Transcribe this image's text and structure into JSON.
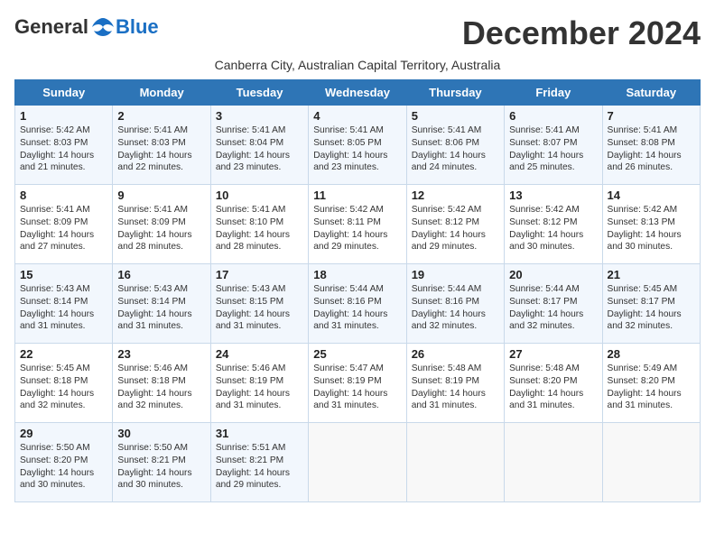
{
  "header": {
    "logo_general": "General",
    "logo_blue": "Blue",
    "month_title": "December 2024",
    "subtitle": "Canberra City, Australian Capital Territory, Australia"
  },
  "days_of_week": [
    "Sunday",
    "Monday",
    "Tuesday",
    "Wednesday",
    "Thursday",
    "Friday",
    "Saturday"
  ],
  "weeks": [
    [
      {
        "day": "1",
        "lines": [
          "Sunrise: 5:42 AM",
          "Sunset: 8:03 PM",
          "Daylight: 14 hours",
          "and 21 minutes."
        ]
      },
      {
        "day": "2",
        "lines": [
          "Sunrise: 5:41 AM",
          "Sunset: 8:03 PM",
          "Daylight: 14 hours",
          "and 22 minutes."
        ]
      },
      {
        "day": "3",
        "lines": [
          "Sunrise: 5:41 AM",
          "Sunset: 8:04 PM",
          "Daylight: 14 hours",
          "and 23 minutes."
        ]
      },
      {
        "day": "4",
        "lines": [
          "Sunrise: 5:41 AM",
          "Sunset: 8:05 PM",
          "Daylight: 14 hours",
          "and 23 minutes."
        ]
      },
      {
        "day": "5",
        "lines": [
          "Sunrise: 5:41 AM",
          "Sunset: 8:06 PM",
          "Daylight: 14 hours",
          "and 24 minutes."
        ]
      },
      {
        "day": "6",
        "lines": [
          "Sunrise: 5:41 AM",
          "Sunset: 8:07 PM",
          "Daylight: 14 hours",
          "and 25 minutes."
        ]
      },
      {
        "day": "7",
        "lines": [
          "Sunrise: 5:41 AM",
          "Sunset: 8:08 PM",
          "Daylight: 14 hours",
          "and 26 minutes."
        ]
      }
    ],
    [
      {
        "day": "8",
        "lines": [
          "Sunrise: 5:41 AM",
          "Sunset: 8:09 PM",
          "Daylight: 14 hours",
          "and 27 minutes."
        ]
      },
      {
        "day": "9",
        "lines": [
          "Sunrise: 5:41 AM",
          "Sunset: 8:09 PM",
          "Daylight: 14 hours",
          "and 28 minutes."
        ]
      },
      {
        "day": "10",
        "lines": [
          "Sunrise: 5:41 AM",
          "Sunset: 8:10 PM",
          "Daylight: 14 hours",
          "and 28 minutes."
        ]
      },
      {
        "day": "11",
        "lines": [
          "Sunrise: 5:42 AM",
          "Sunset: 8:11 PM",
          "Daylight: 14 hours",
          "and 29 minutes."
        ]
      },
      {
        "day": "12",
        "lines": [
          "Sunrise: 5:42 AM",
          "Sunset: 8:12 PM",
          "Daylight: 14 hours",
          "and 29 minutes."
        ]
      },
      {
        "day": "13",
        "lines": [
          "Sunrise: 5:42 AM",
          "Sunset: 8:12 PM",
          "Daylight: 14 hours",
          "and 30 minutes."
        ]
      },
      {
        "day": "14",
        "lines": [
          "Sunrise: 5:42 AM",
          "Sunset: 8:13 PM",
          "Daylight: 14 hours",
          "and 30 minutes."
        ]
      }
    ],
    [
      {
        "day": "15",
        "lines": [
          "Sunrise: 5:43 AM",
          "Sunset: 8:14 PM",
          "Daylight: 14 hours",
          "and 31 minutes."
        ]
      },
      {
        "day": "16",
        "lines": [
          "Sunrise: 5:43 AM",
          "Sunset: 8:14 PM",
          "Daylight: 14 hours",
          "and 31 minutes."
        ]
      },
      {
        "day": "17",
        "lines": [
          "Sunrise: 5:43 AM",
          "Sunset: 8:15 PM",
          "Daylight: 14 hours",
          "and 31 minutes."
        ]
      },
      {
        "day": "18",
        "lines": [
          "Sunrise: 5:44 AM",
          "Sunset: 8:16 PM",
          "Daylight: 14 hours",
          "and 31 minutes."
        ]
      },
      {
        "day": "19",
        "lines": [
          "Sunrise: 5:44 AM",
          "Sunset: 8:16 PM",
          "Daylight: 14 hours",
          "and 32 minutes."
        ]
      },
      {
        "day": "20",
        "lines": [
          "Sunrise: 5:44 AM",
          "Sunset: 8:17 PM",
          "Daylight: 14 hours",
          "and 32 minutes."
        ]
      },
      {
        "day": "21",
        "lines": [
          "Sunrise: 5:45 AM",
          "Sunset: 8:17 PM",
          "Daylight: 14 hours",
          "and 32 minutes."
        ]
      }
    ],
    [
      {
        "day": "22",
        "lines": [
          "Sunrise: 5:45 AM",
          "Sunset: 8:18 PM",
          "Daylight: 14 hours",
          "and 32 minutes."
        ]
      },
      {
        "day": "23",
        "lines": [
          "Sunrise: 5:46 AM",
          "Sunset: 8:18 PM",
          "Daylight: 14 hours",
          "and 32 minutes."
        ]
      },
      {
        "day": "24",
        "lines": [
          "Sunrise: 5:46 AM",
          "Sunset: 8:19 PM",
          "Daylight: 14 hours",
          "and 31 minutes."
        ]
      },
      {
        "day": "25",
        "lines": [
          "Sunrise: 5:47 AM",
          "Sunset: 8:19 PM",
          "Daylight: 14 hours",
          "and 31 minutes."
        ]
      },
      {
        "day": "26",
        "lines": [
          "Sunrise: 5:48 AM",
          "Sunset: 8:19 PM",
          "Daylight: 14 hours",
          "and 31 minutes."
        ]
      },
      {
        "day": "27",
        "lines": [
          "Sunrise: 5:48 AM",
          "Sunset: 8:20 PM",
          "Daylight: 14 hours",
          "and 31 minutes."
        ]
      },
      {
        "day": "28",
        "lines": [
          "Sunrise: 5:49 AM",
          "Sunset: 8:20 PM",
          "Daylight: 14 hours",
          "and 31 minutes."
        ]
      }
    ],
    [
      {
        "day": "29",
        "lines": [
          "Sunrise: 5:50 AM",
          "Sunset: 8:20 PM",
          "Daylight: 14 hours",
          "and 30 minutes."
        ]
      },
      {
        "day": "30",
        "lines": [
          "Sunrise: 5:50 AM",
          "Sunset: 8:21 PM",
          "Daylight: 14 hours",
          "and 30 minutes."
        ]
      },
      {
        "day": "31",
        "lines": [
          "Sunrise: 5:51 AM",
          "Sunset: 8:21 PM",
          "Daylight: 14 hours",
          "and 29 minutes."
        ]
      },
      {
        "day": "",
        "lines": []
      },
      {
        "day": "",
        "lines": []
      },
      {
        "day": "",
        "lines": []
      },
      {
        "day": "",
        "lines": []
      }
    ]
  ]
}
